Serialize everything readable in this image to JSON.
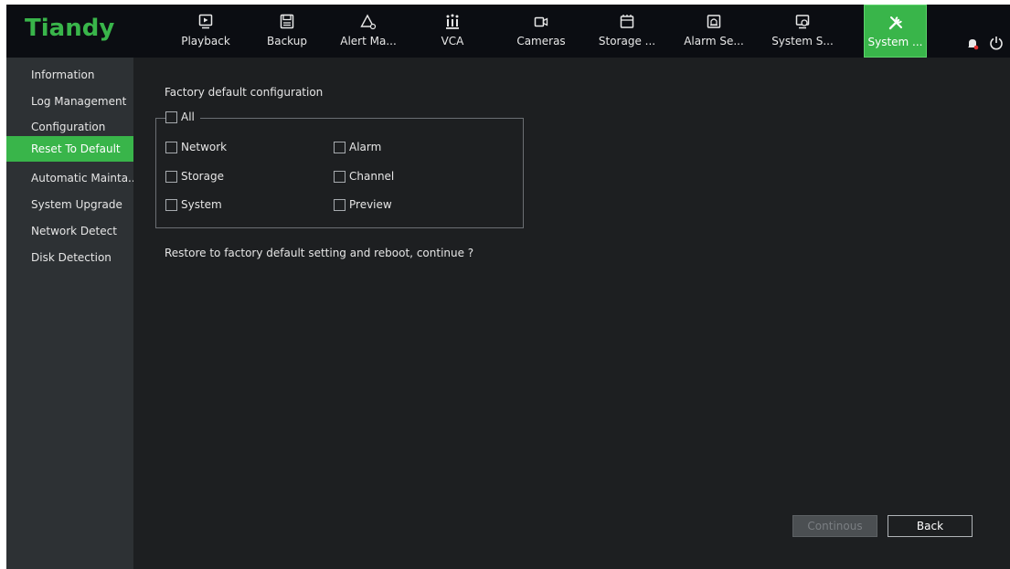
{
  "app": {
    "logo": "Tiandy"
  },
  "nav": {
    "items": [
      {
        "label": "Playback",
        "icon": "playback-icon"
      },
      {
        "label": "Backup",
        "icon": "backup-icon"
      },
      {
        "label": "Alert Ma...",
        "icon": "alert-icon"
      },
      {
        "label": "VCA",
        "icon": "vca-icon"
      },
      {
        "label": "Cameras",
        "icon": "camera-icon"
      },
      {
        "label": "Storage ...",
        "icon": "storage-icon"
      },
      {
        "label": "Alarm Se...",
        "icon": "alarm-icon"
      },
      {
        "label": "System S...",
        "icon": "system-settings-icon"
      },
      {
        "label": "System ...",
        "icon": "tools-icon",
        "active": true
      }
    ]
  },
  "sidebar": {
    "items": [
      {
        "label": "Information"
      },
      {
        "label": "Log Management"
      },
      {
        "label": "Configuration"
      },
      {
        "label": "Reset To Default",
        "active": true
      },
      {
        "label": "Automatic Mainta..."
      },
      {
        "label": "System Upgrade"
      },
      {
        "label": "Network Detect"
      },
      {
        "label": "Disk Detection"
      }
    ]
  },
  "main": {
    "section_title": "Factory default configuration",
    "all_label": "All",
    "options": {
      "network": "Network",
      "alarm": "Alarm",
      "storage": "Storage",
      "channel": "Channel",
      "system": "System",
      "preview": "Preview"
    },
    "prompt": "Restore to factory default setting and reboot, continue ?",
    "buttons": {
      "continous": "Continous",
      "back": "Back"
    }
  },
  "colors": {
    "accent": "#39b54a",
    "topbar_bg": "#0b0d12",
    "sidebar_bg": "#2d3134",
    "main_bg": "#1d1f21"
  }
}
